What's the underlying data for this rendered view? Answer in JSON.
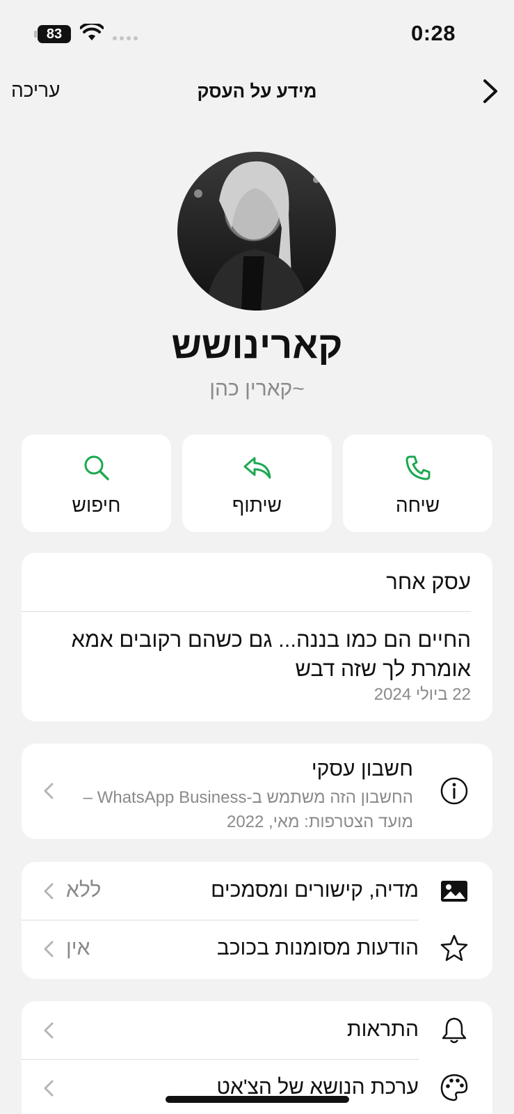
{
  "status_bar": {
    "time": "0:28",
    "battery": "83"
  },
  "nav": {
    "title": "מידע על העסק",
    "edit_label": "עריכה"
  },
  "profile": {
    "name": "קארינושש",
    "subtitle": "~קארין כהן"
  },
  "actions": [
    {
      "label": "שיחה",
      "icon": "phone-icon"
    },
    {
      "label": "שיתוף",
      "icon": "share-icon"
    },
    {
      "label": "חיפוש",
      "icon": "search-icon"
    }
  ],
  "about": {
    "heading": "עסק אחר",
    "text": "החיים הם כמו בננה... גם כשהם רקובים אמא אומרת לך שזה דבש",
    "date": "22 ביולי 2024"
  },
  "business": {
    "title": "חשבון עסקי",
    "description": "החשבון הזה משתמש ב-WhatsApp Business – מועד הצטרפות: מאי, 2022",
    "icon": "info-icon"
  },
  "media_rows": [
    {
      "label": "מדיה, קישורים ומסמכים",
      "value": "ללא",
      "icon": "photo-icon"
    },
    {
      "label": "הודעות מסומנות בכוכב",
      "value": "אין",
      "icon": "star-icon"
    }
  ],
  "settings_rows": [
    {
      "label": "התראות",
      "icon": "bell-icon"
    },
    {
      "label": "ערכת הנושא של הצ'אט",
      "icon": "palette-icon"
    }
  ],
  "colors": {
    "accent": "#1da851",
    "background": "#f2f2f2",
    "card": "#ffffff",
    "secondary_text": "#8a8a8a"
  }
}
